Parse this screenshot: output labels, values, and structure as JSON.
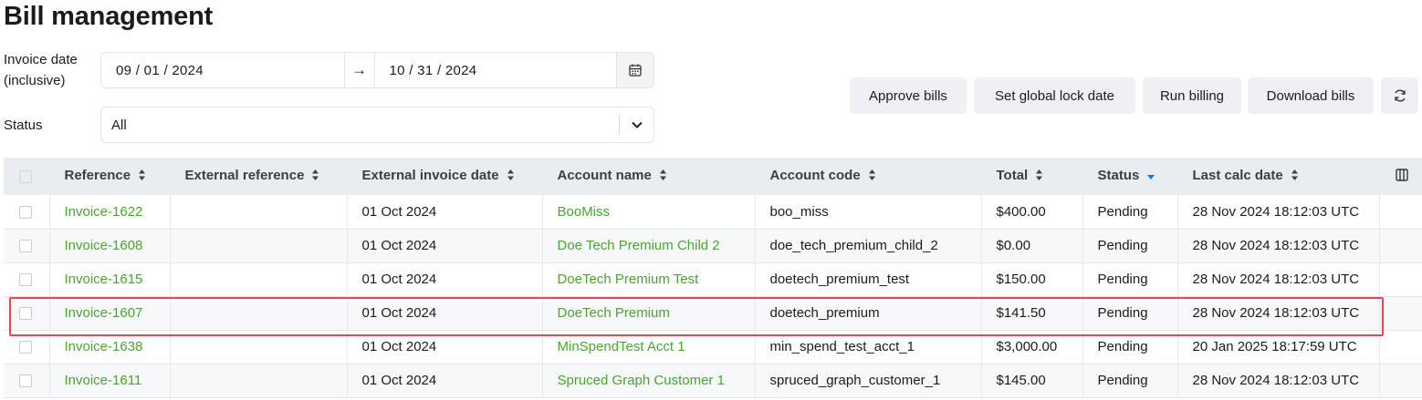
{
  "page": {
    "title": "Bill management"
  },
  "filters": {
    "invoice_date_label_line1": "Invoice date",
    "invoice_date_label_line2": "(inclusive)",
    "date_from": "09 / 01 / 2024",
    "date_separator": "→",
    "date_to": "10 / 31 / 2024",
    "status_label": "Status",
    "status_value": "All"
  },
  "actions": {
    "approve_bills": "Approve bills",
    "set_global_lock_date": "Set global lock date",
    "run_billing": "Run billing",
    "download_bills": "Download bills"
  },
  "table": {
    "columns": [
      "Reference",
      "External reference",
      "External invoice date",
      "Account name",
      "Account code",
      "Total",
      "Status",
      "Last calc date"
    ],
    "rows": [
      {
        "reference": "Invoice-1622",
        "external_reference": "",
        "external_invoice_date": "01 Oct 2024",
        "account_name": "BooMiss",
        "account_code": "boo_miss",
        "total": "$400.00",
        "status": "Pending",
        "last_calc_date": "28 Nov 2024 18:12:03 UTC"
      },
      {
        "reference": "Invoice-1608",
        "external_reference": "",
        "external_invoice_date": "01 Oct 2024",
        "account_name": "Doe Tech Premium Child 2",
        "account_code": "doe_tech_premium_child_2",
        "total": "$0.00",
        "status": "Pending",
        "last_calc_date": "28 Nov 2024 18:12:03 UTC"
      },
      {
        "reference": "Invoice-1615",
        "external_reference": "",
        "external_invoice_date": "01 Oct 2024",
        "account_name": "DoeTech Premium Test",
        "account_code": "doetech_premium_test",
        "total": "$150.00",
        "status": "Pending",
        "last_calc_date": "28 Nov 2024 18:12:03 UTC"
      },
      {
        "reference": "Invoice-1607",
        "external_reference": "",
        "external_invoice_date": "01 Oct 2024",
        "account_name": "DoeTech Premium",
        "account_code": "doetech_premium",
        "total": "$141.50",
        "status": "Pending",
        "last_calc_date": "28 Nov 2024 18:12:03 UTC"
      },
      {
        "reference": "Invoice-1638",
        "external_reference": "",
        "external_invoice_date": "01 Oct 2024",
        "account_name": "MinSpendTest Acct 1",
        "account_code": "min_spend_test_acct_1",
        "total": "$3,000.00",
        "status": "Pending",
        "last_calc_date": "20 Jan 2025 18:17:59 UTC"
      },
      {
        "reference": "Invoice-1611",
        "external_reference": "",
        "external_invoice_date": "01 Oct 2024",
        "account_name": "Spruced Graph Customer 1",
        "account_code": "spruced_graph_customer_1",
        "total": "$145.00",
        "status": "Pending",
        "last_calc_date": "28 Nov 2024 18:12:03 UTC"
      }
    ]
  },
  "colors": {
    "link": "#4aa52e",
    "highlight": "#e5484d",
    "header_bg": "#e9edf2",
    "sort_active": "#2b6fd6"
  },
  "icons": [
    "calendar-icon",
    "chevron-down-icon",
    "refresh-icon",
    "sort-icon",
    "columns-icon"
  ]
}
